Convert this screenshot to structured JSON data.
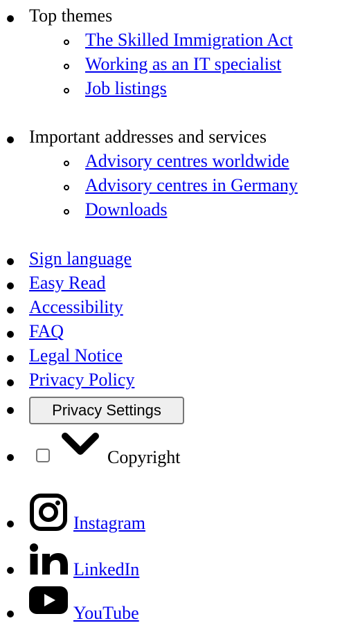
{
  "top_themes": {
    "title": "Top themes",
    "links": [
      "The Skilled Immigration Act",
      "Working as an IT specialist",
      "Job listings"
    ]
  },
  "addresses": {
    "title": "Important addresses and services",
    "links": [
      "Advisory centres worldwide",
      "Advisory centres in Germany",
      "Downloads"
    ]
  },
  "footer_links": [
    "Sign language",
    "Easy Read",
    "Accessibility",
    "FAQ",
    "Legal Notice",
    "Privacy Policy"
  ],
  "privacy_settings_label": "Privacy Settings",
  "copyright_label": "Copyright",
  "social": [
    {
      "label": "Instagram",
      "icon": "instagram-icon"
    },
    {
      "label": "LinkedIn",
      "icon": "linkedin-icon"
    },
    {
      "label": "YouTube",
      "icon": "youtube-icon"
    }
  ]
}
